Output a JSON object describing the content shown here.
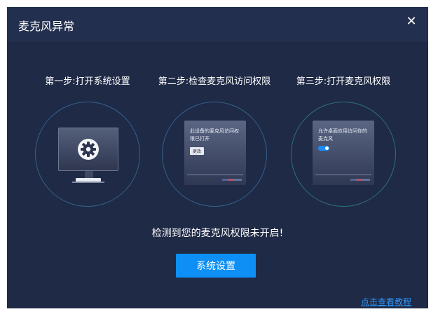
{
  "dialog": {
    "title": "麦克风异常",
    "close_icon": "close-icon"
  },
  "steps": [
    {
      "label": "第一步:打开系统设置",
      "icon": "monitor-settings-icon"
    },
    {
      "label": "第二步:检查麦克风访问权限",
      "card_text": "此设备的麦克风访问权限已打开",
      "card_button": "更改"
    },
    {
      "label": "第三步:打开麦克风权限",
      "card_text": "允许桌面应用访问你的麦克风",
      "toggle_state": "on"
    }
  ],
  "message": "检测到您的麦克风权限未开启!",
  "primary_button": "系统设置",
  "tutorial_link": "点击查看教程",
  "colors": {
    "background": "#1f2a46",
    "accent": "#0d8ff5",
    "link": "#2e93f5",
    "circle_blue": "#35608b",
    "circle_teal": "#2d6f7f"
  }
}
